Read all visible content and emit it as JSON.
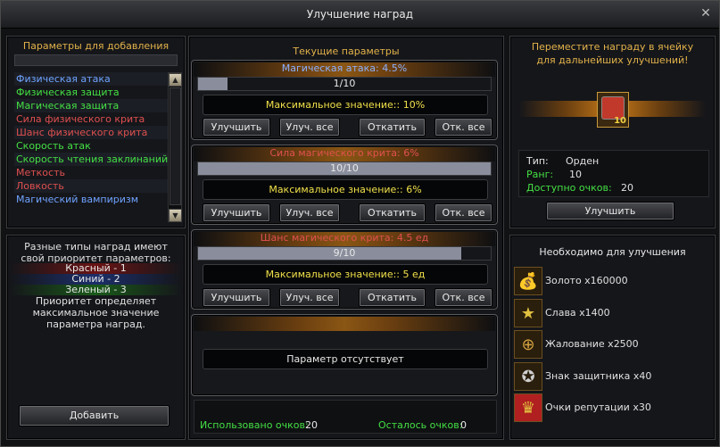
{
  "window": {
    "title": "Улучшение наград",
    "close_label": "✕"
  },
  "left": {
    "header": "Параметры для добавления",
    "params": [
      {
        "label": "Физическая атака",
        "color": "#6fa3ff"
      },
      {
        "label": "Физическая защита",
        "color": "#44e044"
      },
      {
        "label": "Магическая защита",
        "color": "#44e044"
      },
      {
        "label": "Сила физического крита",
        "color": "#e05050"
      },
      {
        "label": "Шанс физического крита",
        "color": "#e05050"
      },
      {
        "label": "Скорость атак",
        "color": "#44e044"
      },
      {
        "label": "Скорость чтения заклинаний",
        "color": "#44e044"
      },
      {
        "label": "Меткость",
        "color": "#e05050"
      },
      {
        "label": "Ловкость",
        "color": "#e05050"
      },
      {
        "label": "Магический вампиризм",
        "color": "#6fa3ff"
      }
    ],
    "info_line1": "Разные типы наград имеют",
    "info_line2": "свой приоритет параметров:",
    "red": "Красный - 1",
    "blue": "Синий - 2",
    "green": "Зеленый - 3",
    "info_line3": "Приоритет определяет",
    "info_line4": "максимальное значение",
    "info_line5": "параметра наград.",
    "add_button": "Добавить"
  },
  "center": {
    "header": "Текущие параметры",
    "slots": [
      {
        "name": "Магическая атака: 4.5%",
        "name_color": "#8ab0ff",
        "progress": "1/10",
        "fill": 0.1,
        "max": "Максимальное значение:: 10%"
      },
      {
        "name": "Сила магического крита: 6%",
        "name_color": "#e05050",
        "progress": "10/10",
        "fill": 1.0,
        "max": "Максимальное значение:: 6%"
      },
      {
        "name": "Шанс магического крита: 4.5 ед",
        "name_color": "#e05050",
        "progress": "9/10",
        "fill": 0.9,
        "max": "Максимальное значение:: 5 ед"
      }
    ],
    "empty_slot": "Параметр отсутствует",
    "buttons": {
      "upgrade": "Улучшить",
      "upgrade_all": "Улуч. все",
      "rollback": "Откатить",
      "rollback_all": "Отк. все"
    },
    "used_label": "Использовано очков:",
    "used_value": "20",
    "left_label": "Осталось очков:",
    "left_value": "0"
  },
  "right": {
    "hint_line1": "Переместите награду в ячейку",
    "hint_line2": "для дальнейших улучшений!",
    "item_level": "10",
    "type_label": "Тип:",
    "type_value": "Орден",
    "rank_label": "Ранг:",
    "rank_value": "10",
    "points_label": "Доступно очков:",
    "points_value": "20",
    "upgrade_button": "Улучшить",
    "req_header": "Необходимо для улучшения",
    "requirements": [
      {
        "label": "Золото x160000",
        "icon": "gold-coins-icon"
      },
      {
        "label": "Слава x1400",
        "icon": "glory-star-icon"
      },
      {
        "label": "Жалование x2500",
        "icon": "salary-coin-icon"
      },
      {
        "label": "Знак защитника x40",
        "icon": "defender-badge-icon"
      },
      {
        "label": "Очки репутации x30",
        "icon": "reputation-crown-icon"
      }
    ]
  }
}
